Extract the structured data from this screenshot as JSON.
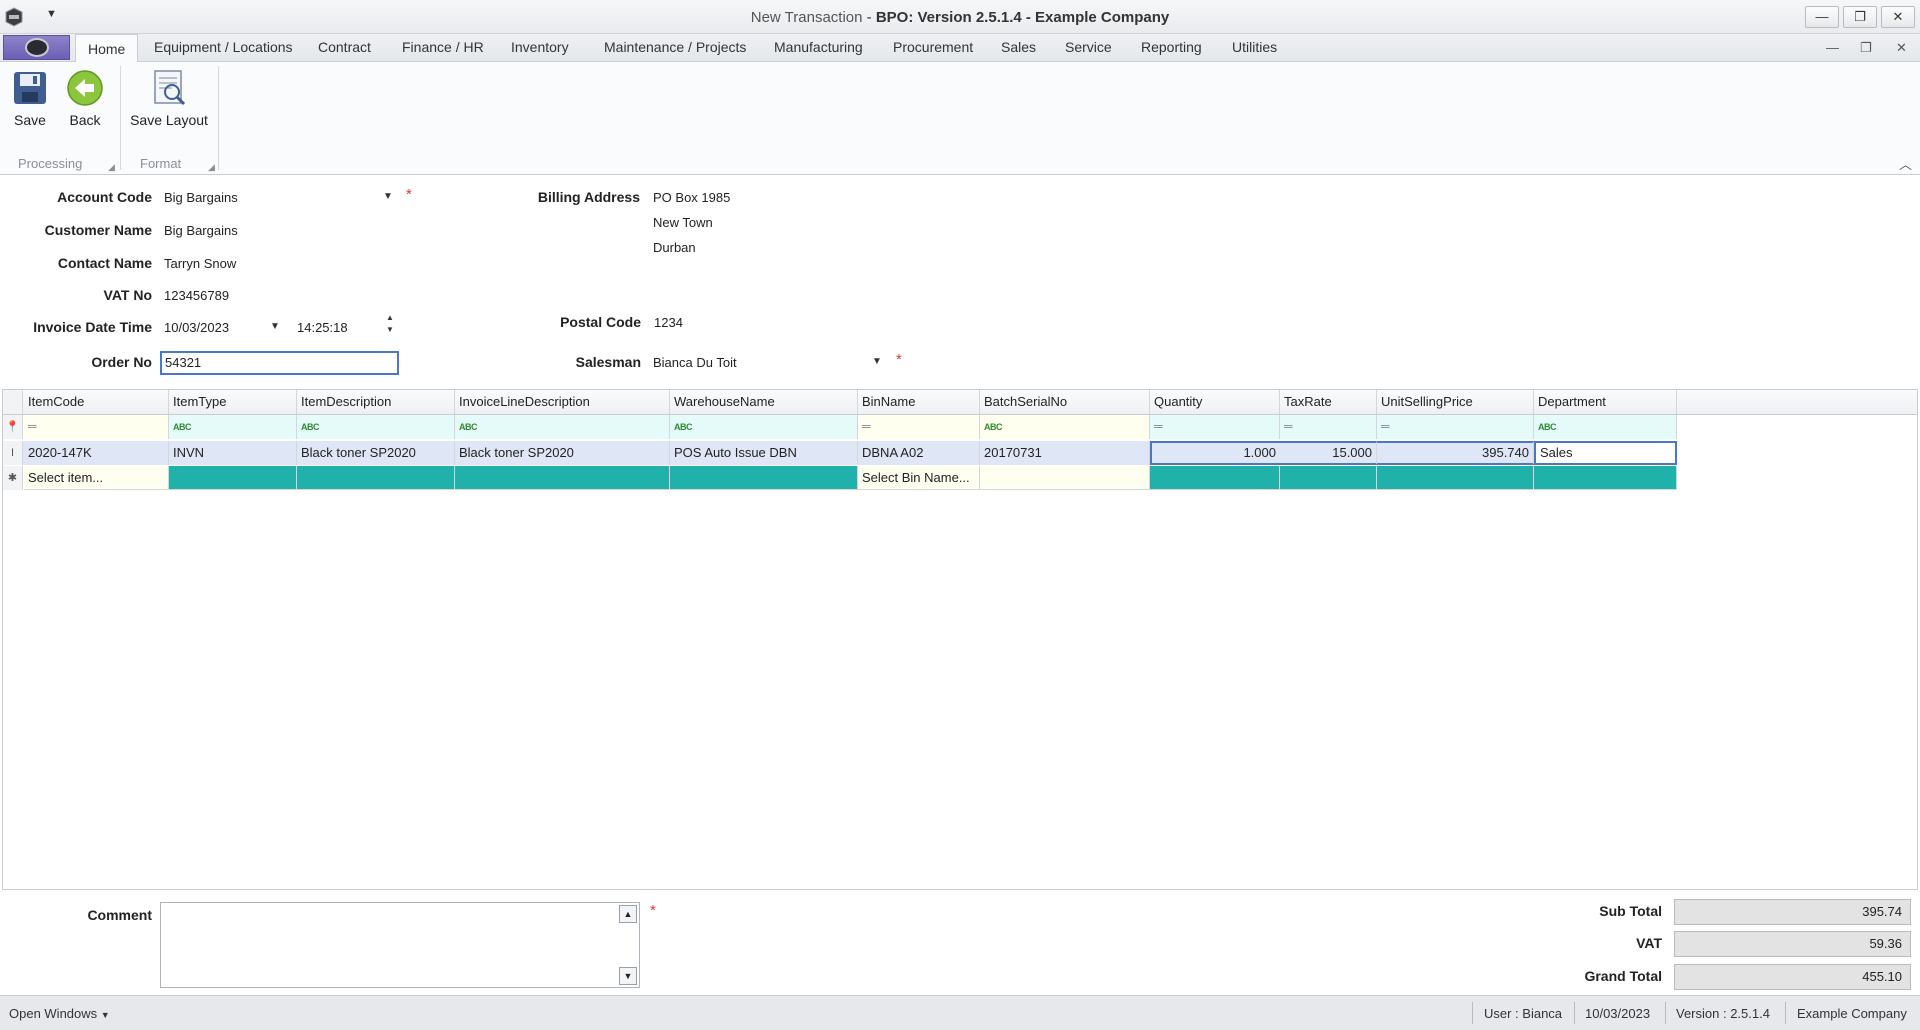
{
  "window": {
    "title_prefix": "New Transaction",
    "title_sep": " - ",
    "title_main": "BPO: Version 2.5.1.4 - Example Company",
    "minimize": "—",
    "restore": "❐",
    "close": "✕"
  },
  "tabs": [
    "Home",
    "Equipment / Locations",
    "Contract",
    "Finance / HR",
    "Inventory",
    "Maintenance / Projects",
    "Manufacturing",
    "Procurement",
    "Sales",
    "Service",
    "Reporting",
    "Utilities"
  ],
  "ribbon": {
    "save": "Save",
    "back": "Back",
    "save_layout": "Save Layout",
    "group_processing": "Processing",
    "group_format": "Format"
  },
  "form": {
    "account_code_label": "Account Code",
    "account_code": "Big Bargains",
    "customer_name_label": "Customer Name",
    "customer_name": "Big Bargains",
    "contact_name_label": "Contact Name",
    "contact_name": "Tarryn Snow",
    "vat_no_label": "VAT No",
    "vat_no": "123456789",
    "invoice_datetime_label": "Invoice Date Time",
    "invoice_date": "10/03/2023",
    "invoice_time": "14:25:18",
    "order_no_label": "Order No",
    "order_no": "54321",
    "billing_address_label": "Billing Address",
    "billing_address_1": "PO Box 1985",
    "billing_address_2": "New Town",
    "billing_address_3": "Durban",
    "postal_code_label": "Postal Code",
    "postal_code": "1234",
    "salesman_label": "Salesman",
    "salesman": "Bianca Du Toit",
    "required_mark": "*"
  },
  "grid": {
    "columns": [
      "ItemCode",
      "ItemType",
      "ItemDescription",
      "InvoiceLineDescription",
      "WarehouseName",
      "BinName",
      "BatchSerialNo",
      "Quantity",
      "TaxRate",
      "UnitSellingPrice",
      "Department"
    ],
    "row": {
      "ItemCode": "2020-147K",
      "ItemType": "INVN",
      "ItemDescription": "Black toner SP2020",
      "InvoiceLineDescription": "Black toner SP2020",
      "WarehouseName": "POS Auto Issue DBN",
      "BinName": "DBNA A02",
      "BatchSerialNo": "20170731",
      "Quantity": "1.000",
      "TaxRate": "15.000",
      "UnitSellingPrice": "395.740",
      "Department": "Sales"
    },
    "new_row": {
      "item_placeholder": "Select item...",
      "bin_placeholder": "Select Bin Name..."
    }
  },
  "bottom": {
    "comment_label": "Comment",
    "sub_total_label": "Sub Total",
    "sub_total": "395.74",
    "vat_label": "VAT",
    "vat": "59.36",
    "grand_total_label": "Grand Total",
    "grand_total": "455.10"
  },
  "status": {
    "open_windows": "Open Windows",
    "user": "User : Bianca",
    "date": "10/03/2023",
    "version": "Version : 2.5.1.4",
    "company": "Example Company"
  },
  "colors": {
    "accent_blue": "#4a78c8",
    "required_red": "#e0392e",
    "new_row_teal": "#20b2aa",
    "filter_yellow": "#fffff0",
    "selected_row": "#dfe6f6"
  }
}
